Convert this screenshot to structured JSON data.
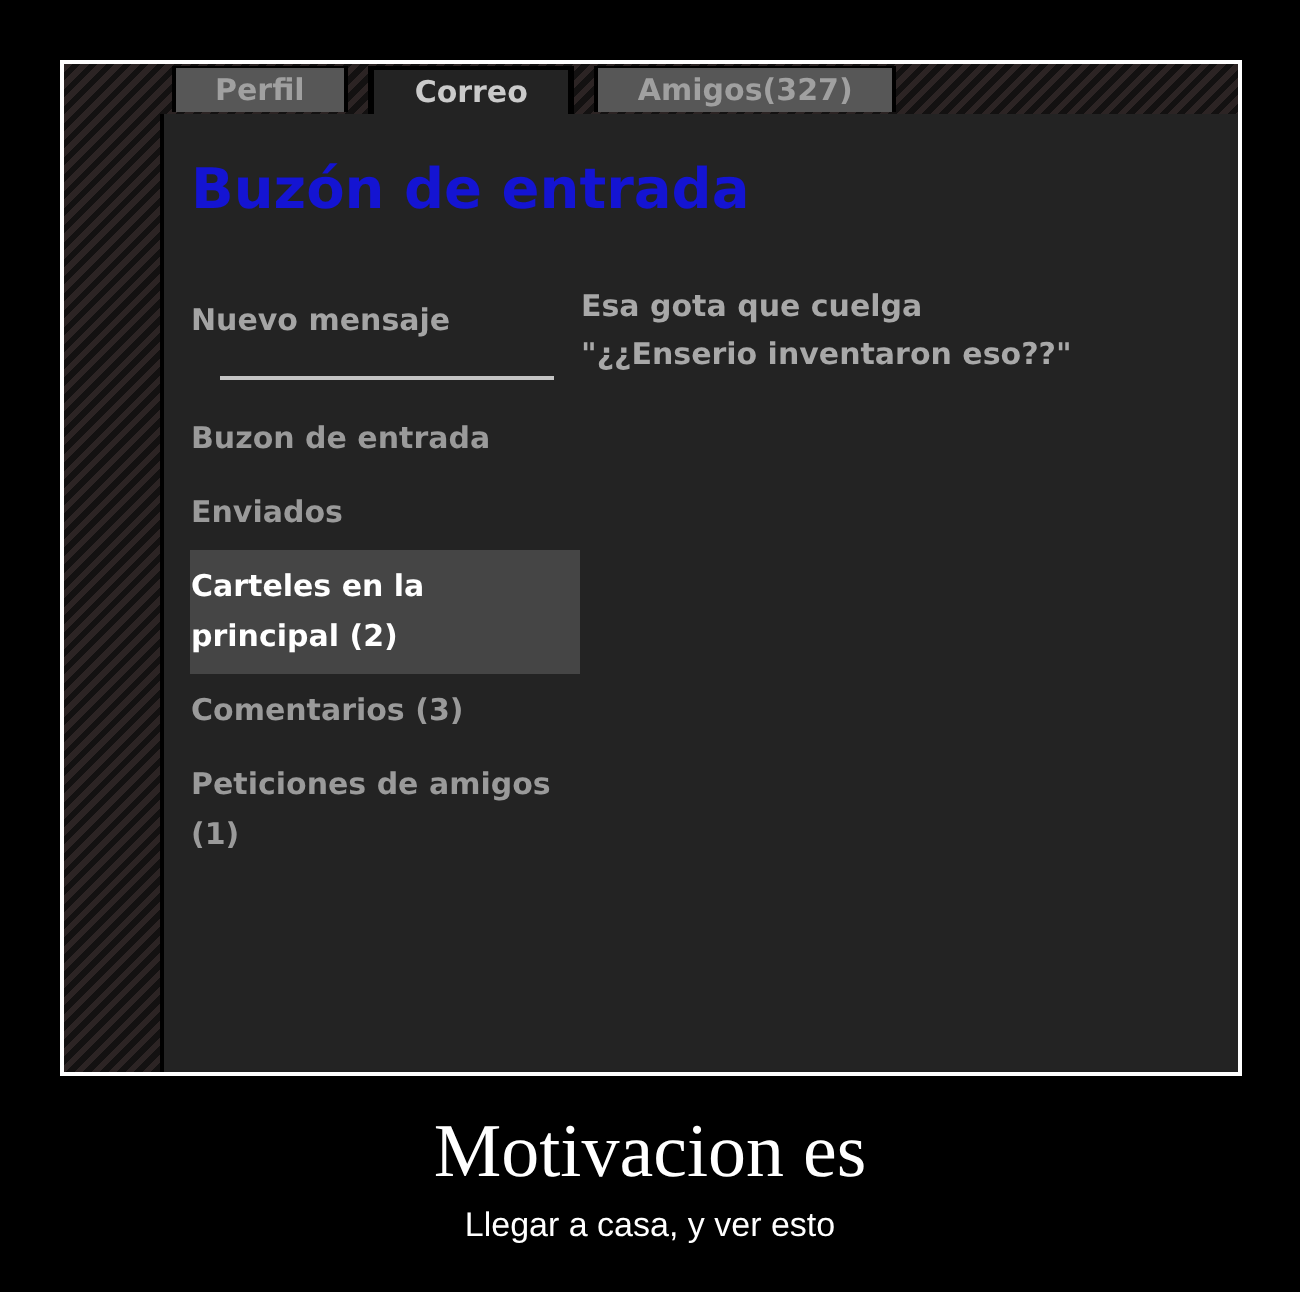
{
  "screenshot": {
    "tabs": [
      {
        "label": "Perfil",
        "selected": false
      },
      {
        "label": "Correo",
        "selected": true
      },
      {
        "label": "Amigos(327)",
        "selected": false
      }
    ],
    "heading": "Buzón de entrada",
    "new_message": "Nuevo mensaje",
    "folders": [
      {
        "label": "Buzon de entrada",
        "selected": false
      },
      {
        "label": "Enviados",
        "selected": false
      },
      {
        "label": "Carteles en la principal (2)",
        "selected": true
      },
      {
        "label": "Comentarios (3)",
        "selected": false
      },
      {
        "label": "Peticiones de amigos (1)",
        "selected": false
      }
    ],
    "message": {
      "subject": "Esa gota que cuelga",
      "excerpt": "\"¿¿Enserio inventaron eso??\""
    }
  },
  "caption": {
    "title": "Motivacion es",
    "subtitle": "Llegar a casa, y ver esto"
  }
}
